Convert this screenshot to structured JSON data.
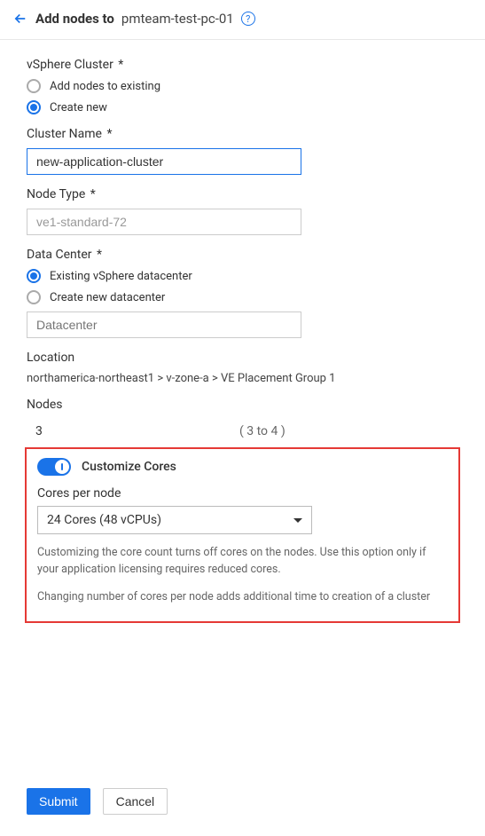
{
  "header": {
    "title_static": "Add nodes to",
    "title_dynamic": "pmteam-test-pc-01",
    "help_symbol": "?"
  },
  "vsphere_cluster": {
    "label": "vSphere Cluster",
    "option_existing": "Add nodes to existing",
    "option_new": "Create new",
    "selected": "new"
  },
  "cluster_name": {
    "label": "Cluster Name",
    "value": "new-application-cluster"
  },
  "node_type": {
    "label": "Node Type",
    "value": "ve1-standard-72"
  },
  "data_center": {
    "label": "Data Center",
    "option_existing": "Existing vSphere datacenter",
    "option_new": "Create new datacenter",
    "selected": "existing",
    "placeholder": "Datacenter"
  },
  "location": {
    "label": "Location",
    "value": "northamerica-northeast1 > v-zone-a > VE Placement Group 1"
  },
  "nodes": {
    "label": "Nodes",
    "value": "3",
    "range": "( 3 to 4 )"
  },
  "customize": {
    "toggle_label": "Customize Cores",
    "cores_label": "Cores per node",
    "cores_value": "24 Cores (48 vCPUs)",
    "help1": "Customizing the core count turns off cores on the nodes. Use this option only if your application licensing requires reduced cores.",
    "help2": "Changing number of cores per node adds additional time to creation of a cluster"
  },
  "footer": {
    "submit": "Submit",
    "cancel": "Cancel"
  }
}
